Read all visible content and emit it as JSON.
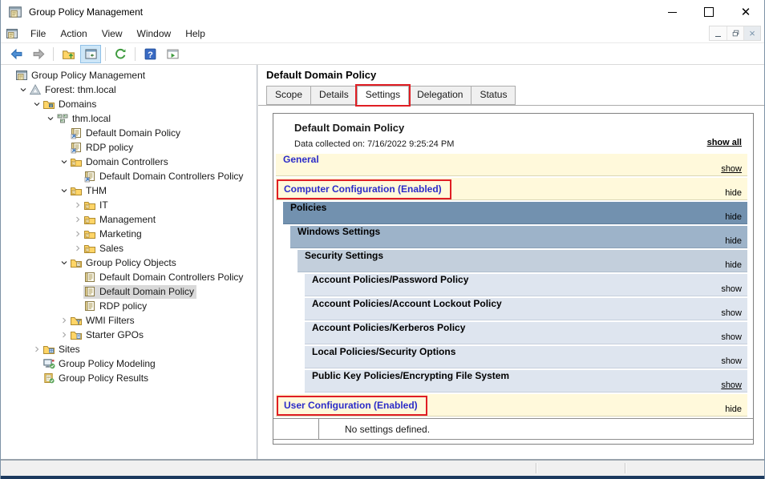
{
  "window": {
    "title": "Group Policy Management",
    "controls": [
      {
        "name": "minimize",
        "label": "minimize"
      },
      {
        "name": "maximize",
        "label": "maximize"
      },
      {
        "name": "close",
        "label": "close"
      }
    ]
  },
  "menubar": {
    "items": [
      "File",
      "Action",
      "View",
      "Window",
      "Help"
    ],
    "mdi_controls": [
      "minimize",
      "restore",
      "close"
    ]
  },
  "toolbar": {
    "buttons": [
      {
        "icon": "back-icon"
      },
      {
        "icon": "forward-icon"
      },
      {
        "sep": true
      },
      {
        "icon": "up-one-level-icon"
      },
      {
        "icon": "console-tree-toggle-icon",
        "pressed": true
      },
      {
        "sep": true
      },
      {
        "icon": "export-list-icon"
      },
      {
        "sep": true
      },
      {
        "icon": "help-icon"
      },
      {
        "icon": "new-window-icon"
      }
    ]
  },
  "tree": {
    "items": [
      {
        "label": "Group Policy Management",
        "depth": 0,
        "chevron": "none",
        "icon": "console"
      },
      {
        "label": "Forest: thm.local",
        "depth": 1,
        "chevron": "expanded",
        "icon": "forest"
      },
      {
        "label": "Domains",
        "depth": 2,
        "chevron": "expanded",
        "icon": "domains-folder"
      },
      {
        "label": "thm.local",
        "depth": 3,
        "chevron": "expanded",
        "icon": "domain"
      },
      {
        "label": "Default Domain Policy",
        "depth": 4,
        "chevron": "none",
        "icon": "gpo-link"
      },
      {
        "label": "RDP policy",
        "depth": 4,
        "chevron": "none",
        "icon": "gpo-link"
      },
      {
        "label": "Domain Controllers",
        "depth": 4,
        "chevron": "expanded",
        "icon": "ou-folder"
      },
      {
        "label": "Default Domain Controllers Policy",
        "depth": 5,
        "chevron": "none",
        "icon": "gpo-link"
      },
      {
        "label": "THM",
        "depth": 4,
        "chevron": "expanded",
        "icon": "ou-folder"
      },
      {
        "label": "IT",
        "depth": 5,
        "chevron": "collapsed",
        "icon": "ou-folder"
      },
      {
        "label": "Management",
        "depth": 5,
        "chevron": "collapsed",
        "icon": "ou-folder"
      },
      {
        "label": "Marketing",
        "depth": 5,
        "chevron": "collapsed",
        "icon": "ou-folder"
      },
      {
        "label": "Sales",
        "depth": 5,
        "chevron": "collapsed",
        "icon": "ou-folder"
      },
      {
        "label": "Group Policy Objects",
        "depth": 4,
        "chevron": "expanded",
        "icon": "gpo-folder"
      },
      {
        "label": "Default Domain Controllers Policy",
        "depth": 5,
        "chevron": "none",
        "icon": "gpo"
      },
      {
        "label": "Default Domain Policy",
        "depth": 5,
        "chevron": "none",
        "icon": "gpo",
        "selected": true
      },
      {
        "label": "RDP policy",
        "depth": 5,
        "chevron": "none",
        "icon": "gpo"
      },
      {
        "label": "WMI Filters",
        "depth": 4,
        "chevron": "collapsed",
        "icon": "wmi-folder"
      },
      {
        "label": "Starter GPOs",
        "depth": 4,
        "chevron": "collapsed",
        "icon": "starter-folder"
      },
      {
        "label": "Sites",
        "depth": 2,
        "chevron": "collapsed",
        "icon": "sites-folder"
      },
      {
        "label": "Group Policy Modeling",
        "depth": 2,
        "chevron": "none",
        "icon": "modeling"
      },
      {
        "label": "Group Policy Results",
        "depth": 2,
        "chevron": "none",
        "icon": "results"
      }
    ]
  },
  "pane": {
    "title": "Default Domain Policy"
  },
  "tabs": {
    "items": [
      {
        "label": "Scope"
      },
      {
        "label": "Details"
      },
      {
        "label": "Settings",
        "selected": true,
        "boxed": true
      },
      {
        "label": "Delegation"
      },
      {
        "label": "Status"
      }
    ]
  },
  "report": {
    "title": "Default Domain Policy",
    "collected": "Data collected on: 7/16/2022 9:25:24 PM",
    "show_all": "show all",
    "sections": [
      {
        "label": "General",
        "level": 0,
        "style": "yellow",
        "action": "show",
        "underline": true,
        "boxed": false
      },
      {
        "label": "Computer Configuration (Enabled)",
        "level": 0,
        "style": "yellow",
        "action": "hide",
        "underline": false,
        "boxed": true
      },
      {
        "label": "Policies",
        "level": 1,
        "style": "blue1",
        "action": "hide",
        "underline": false,
        "boxed": false
      },
      {
        "label": "Windows Settings",
        "level": 2,
        "style": "blue2",
        "action": "hide",
        "underline": false,
        "boxed": false
      },
      {
        "label": "Security Settings",
        "level": 3,
        "style": "blue3",
        "action": "hide",
        "underline": false,
        "boxed": false
      },
      {
        "label": "Account Policies/Password Policy",
        "level": 4,
        "style": "blue4",
        "action": "show",
        "underline": false,
        "boxed": false
      },
      {
        "label": "Account Policies/Account Lockout Policy",
        "level": 4,
        "style": "blue4",
        "action": "show",
        "underline": false,
        "boxed": false
      },
      {
        "label": "Account Policies/Kerberos Policy",
        "level": 4,
        "style": "blue4",
        "action": "show",
        "underline": false,
        "boxed": false
      },
      {
        "label": "Local Policies/Security Options",
        "level": 4,
        "style": "blue4",
        "action": "show",
        "underline": false,
        "boxed": false
      },
      {
        "label": "Public Key Policies/Encrypting File System",
        "level": 4,
        "style": "blue4",
        "action": "show",
        "underline": true,
        "boxed": false
      },
      {
        "label": "User Configuration (Enabled)",
        "level": 0,
        "style": "yellow",
        "action": "hide",
        "underline": false,
        "boxed": true
      }
    ],
    "no_settings": "No settings defined."
  },
  "colors": {
    "highlight_red": "#E01E24",
    "section_yellow": "#FFF9DB",
    "section_blue_dark": "#7291AF",
    "section_blue_mid": "#9DB3C9",
    "section_blue_light": "#C3CFDC",
    "section_blue_row": "#DEE5EF",
    "link_blue": "#2B2BC8",
    "selection_gray": "#D9D9D9",
    "bottom_border_navy": "#1C3A5E"
  }
}
